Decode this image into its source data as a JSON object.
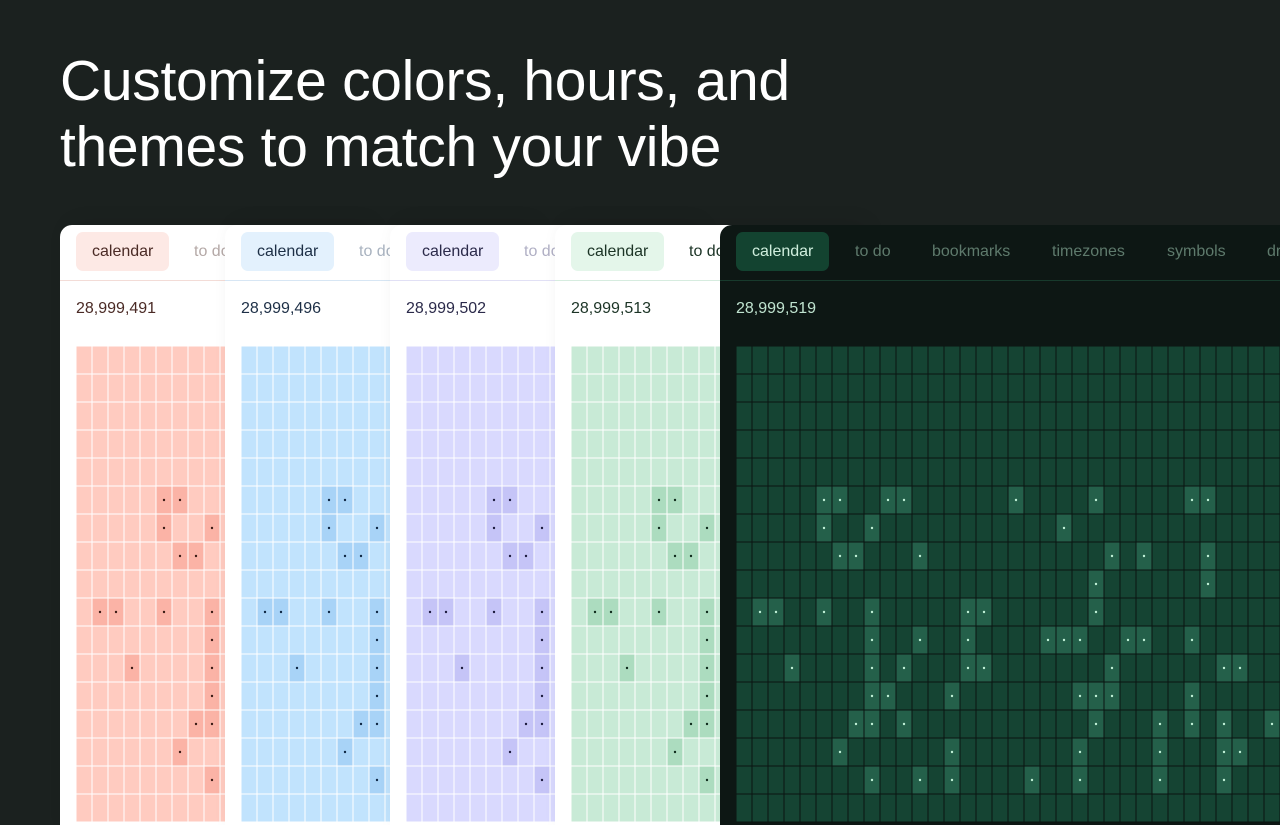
{
  "headline": {
    "line1": "Customize colors, hours, and",
    "line2": "themes to match your vibe"
  },
  "tabs": [
    "calendar",
    "to do",
    "bookmarks",
    "timezones",
    "symbols",
    "dr"
  ],
  "colors": {
    "page_background": "#1b211f",
    "headline_text": "#ffffff"
  },
  "panels": [
    {
      "theme": "coral",
      "count": "28,999,491",
      "colors": {
        "bg": "#ffffff",
        "text": "#4a2a25",
        "tab_text": "#4a2a25",
        "inactive_tab": "#b4a8a6",
        "active_tab_bg": "#fde9e5",
        "line": "#f3dcd7",
        "cell": "#ffcbc0",
        "cell_hi": "#fbb3a6",
        "dot": "#3a1a14",
        "gridline": "#ffffff"
      }
    },
    {
      "theme": "sky",
      "count": "28,999,496",
      "colors": {
        "bg": "#ffffff",
        "text": "#1d2f46",
        "tab_text": "#1d2f46",
        "inactive_tab": "#a8b2bf",
        "active_tab_bg": "#e3f1fd",
        "line": "#d7e6f4",
        "cell": "#c1e3fd",
        "cell_hi": "#a8d3f7",
        "dot": "#0f2744",
        "gridline": "#ffffff"
      }
    },
    {
      "theme": "lavender",
      "count": "28,999,502",
      "colors": {
        "bg": "#ffffff",
        "text": "#2b2a4a",
        "tab_text": "#2b2a4a",
        "inactive_tab": "#b0afc4",
        "active_tab_bg": "#ecebfd",
        "line": "#e1e0f5",
        "cell": "#d9d9fe",
        "cell_hi": "#c5c4f7",
        "dot": "#1c1b3d",
        "gridline": "#ffffff"
      }
    },
    {
      "theme": "mint",
      "count": "28,999,513",
      "colors": {
        "bg": "#ffffff",
        "text": "#1c3426",
        "tab_text": "#1c3426",
        "inactive_tab": "#1c3426",
        "active_tab_bg": "#e4f6ea",
        "line": "#d6ecdf",
        "cell": "#c8ead6",
        "cell_hi": "#acdcbf",
        "dot": "#0f2b1c",
        "gridline": "#ffffff"
      }
    },
    {
      "theme": "forest-dark",
      "count": "28,999,519",
      "colors": {
        "bg": "#0d1714",
        "text": "#bfe3cf",
        "tab_text": "#cfeedd",
        "inactive_tab": "#5e7a6c",
        "active_tab_bg": "#134330",
        "line": "#173a2c",
        "cell": "#154433",
        "cell_hi": "#24604a",
        "dot": "#bff0d6",
        "gridline": "#0a1411"
      }
    }
  ]
}
